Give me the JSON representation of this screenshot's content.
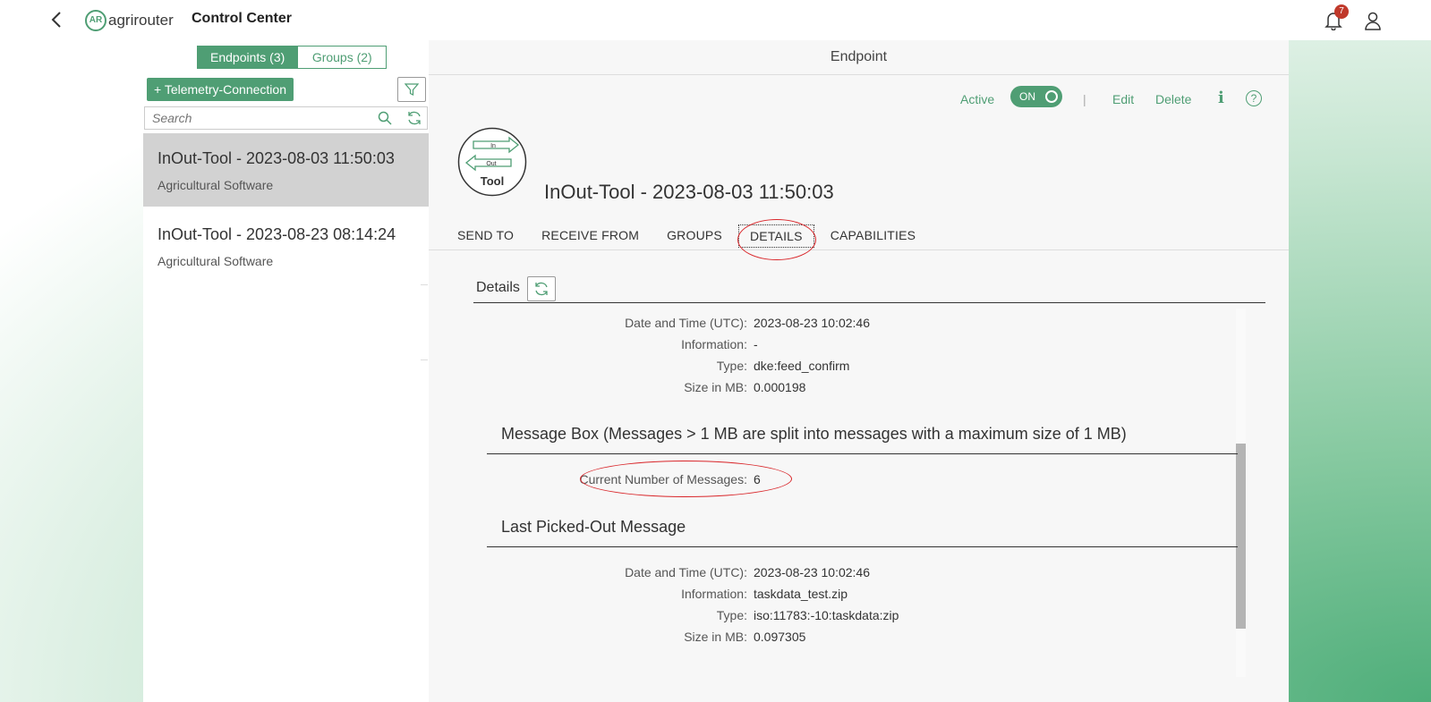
{
  "header": {
    "brand": "agrirouter",
    "brand_mark": "AR",
    "title": "Control Center",
    "notifications_count": "7"
  },
  "sidebar": {
    "segments": {
      "endpoints": "Endpoints (3)",
      "groups": "Groups (2)"
    },
    "add_button": "+ Telemetry-Connection",
    "search_placeholder": "Search",
    "items": [
      {
        "title": "InOut-Tool - 2023-08-03 11:50:03",
        "subtitle": "Agricultural Software"
      },
      {
        "title": "InOut-Tool - 2023-08-23 08:14:24",
        "subtitle": "Agricultural Software"
      }
    ]
  },
  "endpoint": {
    "header": "Endpoint",
    "active_label": "Active",
    "toggle_label": "ON",
    "edit": "Edit",
    "delete": "Delete",
    "title": "InOut-Tool - 2023-08-03 11:50:03",
    "icon_text": {
      "in": "In",
      "out": "Out",
      "tool": "Tool"
    },
    "tabs": [
      "SEND TO",
      "RECEIVE FROM",
      "GROUPS",
      "DETAILS",
      "CAPABILITIES"
    ]
  },
  "details": {
    "title": "Details",
    "first_block": [
      {
        "label": "Date and Time (UTC):",
        "value": "2023-08-23 10:02:46"
      },
      {
        "label": "Information:",
        "value": "-"
      },
      {
        "label": "Type:",
        "value": "dke:feed_confirm"
      },
      {
        "label": "Size in MB:",
        "value": "0.000198"
      }
    ],
    "message_box_title": "Message Box (Messages > 1 MB are split into messages with a maximum size of 1 MB)",
    "message_box": [
      {
        "label": "Current Number of Messages:",
        "value": "6"
      }
    ],
    "last_picked_title": "Last Picked-Out Message",
    "last_picked": [
      {
        "label": "Date and Time (UTC):",
        "value": "2023-08-23 10:02:46"
      },
      {
        "label": "Information:",
        "value": "taskdata_test.zip"
      },
      {
        "label": "Type:",
        "value": "iso:11783:-10:taskdata:zip"
      },
      {
        "label": "Size in MB:",
        "value": "0.097305"
      }
    ]
  },
  "colors": {
    "accent": "#4f9e74",
    "badge": "#c0392b",
    "highlight_ring": "#d9262a"
  },
  "icons": [
    "back-chevron-icon",
    "bell-icon",
    "user-icon",
    "filter-icon",
    "search-icon",
    "refresh-icon",
    "info-icon",
    "help-icon"
  ]
}
